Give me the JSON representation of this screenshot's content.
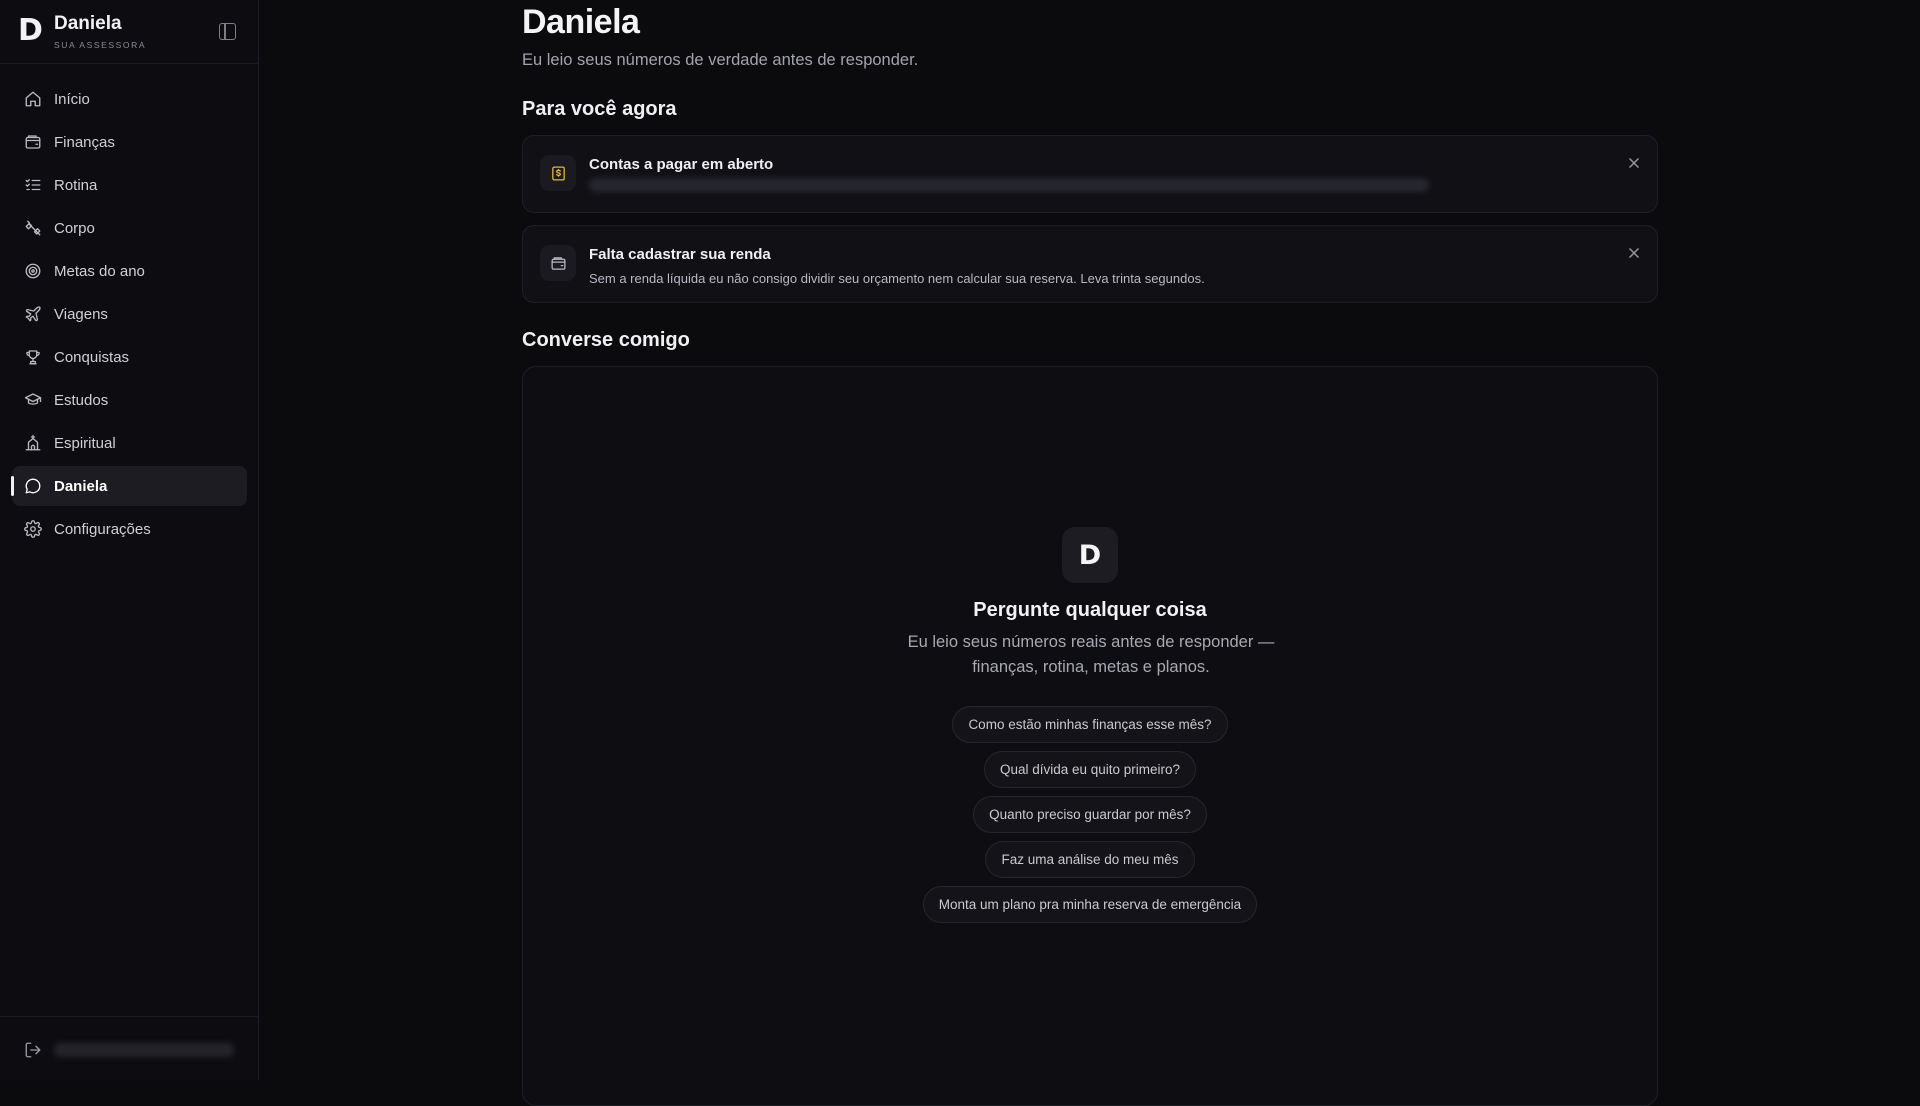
{
  "brand": {
    "logo": "D",
    "name": "Daniela",
    "subtitle": "SUA ASSESSORA"
  },
  "sidebar": {
    "items": [
      {
        "label": "Início",
        "icon": "home-icon",
        "active": false
      },
      {
        "label": "Finanças",
        "icon": "wallet-icon",
        "active": false
      },
      {
        "label": "Rotina",
        "icon": "list-check-icon",
        "active": false
      },
      {
        "label": "Corpo",
        "icon": "dumbbell-icon",
        "active": false
      },
      {
        "label": "Metas do ano",
        "icon": "target-icon",
        "active": false
      },
      {
        "label": "Viagens",
        "icon": "plane-icon",
        "active": false
      },
      {
        "label": "Conquistas",
        "icon": "trophy-icon",
        "active": false
      },
      {
        "label": "Estudos",
        "icon": "graduation-cap-icon",
        "active": false
      },
      {
        "label": "Espiritual",
        "icon": "church-icon",
        "active": false
      },
      {
        "label": "Daniela",
        "icon": "chat-bubble-icon",
        "active": true
      },
      {
        "label": "Configurações",
        "icon": "gear-icon",
        "active": false
      }
    ],
    "footer": {
      "icon": "logout-icon"
    }
  },
  "main": {
    "title": "Daniela",
    "subtitle": "Eu leio seus números de verdade antes de responder.",
    "for_you_title": "Para você agora",
    "cards": [
      {
        "title": "Contas a pagar em aberto",
        "text": "",
        "icon": "receipt-dollar-icon",
        "accent": "#e5b83a"
      },
      {
        "title": "Falta cadastrar sua renda",
        "text": "Sem a renda líquida eu não consigo dividir seu orçamento nem calcular sua reserva. Leva trinta segundos.",
        "icon": "wallet-icon"
      }
    ],
    "chat_title": "Converse comigo",
    "chat": {
      "avatar": "D",
      "heading": "Pergunte qualquer coisa",
      "description": "Eu leio seus números reais antes de responder — finanças, rotina, metas e planos.",
      "suggestions": [
        "Como estão minhas finanças esse mês?",
        "Qual dívida eu quito primeiro?",
        "Quanto preciso guardar por mês?",
        "Faz uma análise do meu mês",
        "Monta um plano pra minha reserva de emergência"
      ]
    }
  },
  "colors": {
    "background": "#0b0b0e",
    "sidebar": "#0d0d11",
    "accent": "#e5b83a"
  }
}
